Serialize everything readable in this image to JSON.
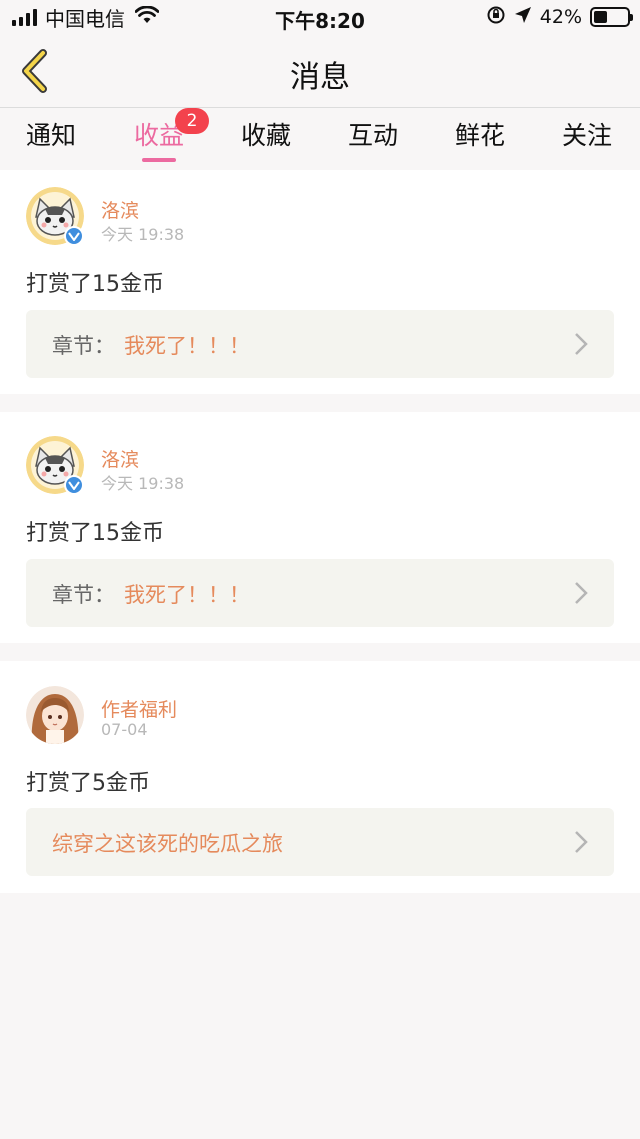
{
  "status_bar": {
    "carrier": "中国电信",
    "time": "下午8:20",
    "battery_percent": "42%",
    "battery_level": 0.42
  },
  "nav": {
    "title": "消息"
  },
  "tabs": [
    {
      "label": "通知"
    },
    {
      "label": "收益",
      "badge": "2",
      "active": true
    },
    {
      "label": "收藏"
    },
    {
      "label": "互动"
    },
    {
      "label": "鲜花"
    },
    {
      "label": "关注"
    }
  ],
  "messages": [
    {
      "user": "洛滨",
      "time": "今天 19:38",
      "action": "打赏了15金币",
      "ref_label": "章节：",
      "ref_value": "我死了！！！",
      "avatar": "cat-avatar",
      "verified": true
    },
    {
      "user": "洛滨",
      "time": "今天 19:38",
      "action": "打赏了15金币",
      "ref_label": "章节：",
      "ref_value": "我死了！！！",
      "avatar": "cat-avatar",
      "verified": true
    },
    {
      "user": "作者福利",
      "time": "07-04",
      "action": "打赏了5金币",
      "ref_label": "",
      "ref_value": "综穿之这该死的吃瓜之旅",
      "avatar": "girl-avatar",
      "verified": false
    }
  ],
  "colors": {
    "accent_pink": "#ec6aa0",
    "username_orange": "#e58a5c",
    "badge_red": "#f3424d",
    "back_icon_yellow": "#f4d54a"
  }
}
